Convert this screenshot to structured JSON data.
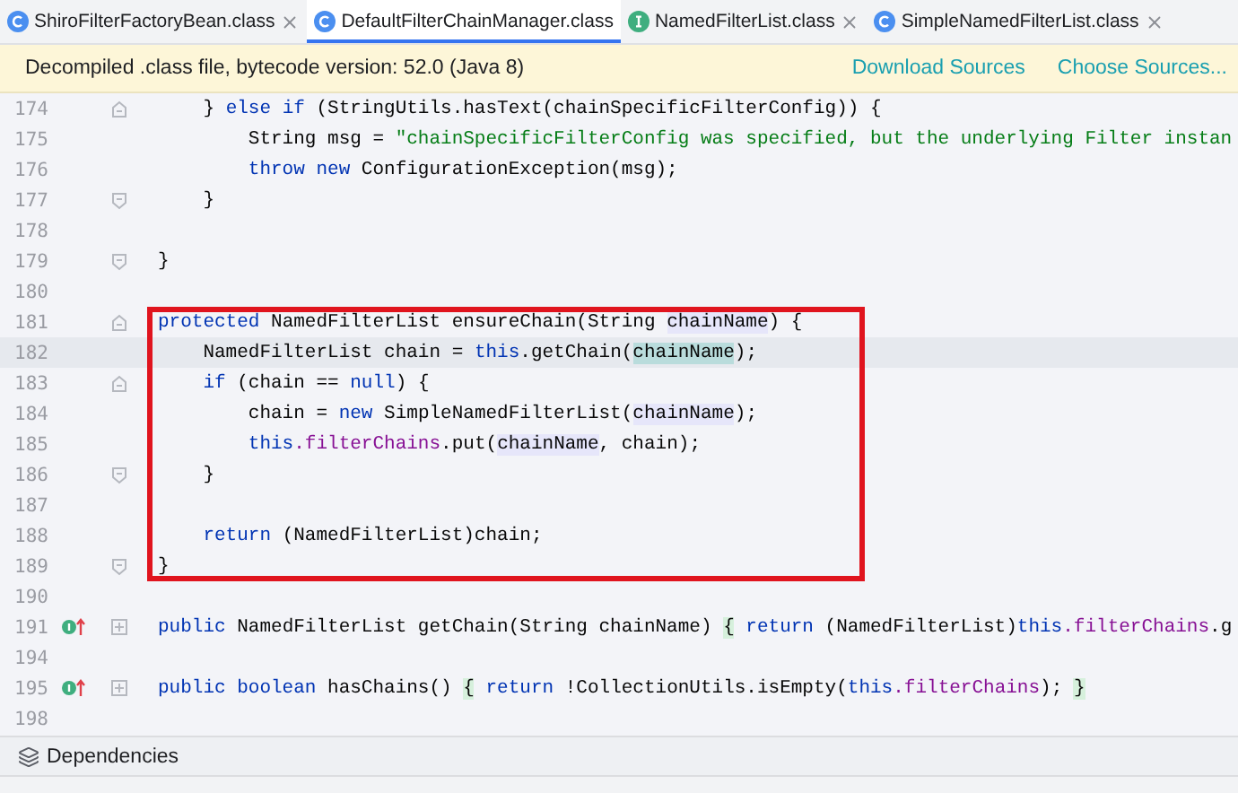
{
  "tabs": [
    {
      "label": "ShiroFilterFactoryBean.class",
      "kind": "class",
      "selected": false,
      "closable": true
    },
    {
      "label": "DefaultFilterChainManager.class",
      "kind": "class",
      "selected": true,
      "closable": false
    },
    {
      "label": "NamedFilterList.class",
      "kind": "interface",
      "selected": false,
      "closable": true
    },
    {
      "label": "SimpleNamedFilterList.class",
      "kind": "class",
      "selected": false,
      "closable": true
    }
  ],
  "banner": {
    "message": "Decompiled .class file, bytecode version: 52.0 (Java 8)",
    "links": [
      "Download Sources",
      "Choose Sources..."
    ]
  },
  "code_lines": [
    {
      "number": "174",
      "gutter": [
        {
          "kind": "fold_start"
        }
      ],
      "current": false,
      "boxed": false,
      "tokens": [
        {
          "kind": "plain",
          "text": "    } "
        },
        {
          "kind": "keyword",
          "text": "else if"
        },
        {
          "kind": "plain",
          "text": " (StringUtils.hasText(chainSpecificFilterConfig)) {"
        }
      ]
    },
    {
      "number": "175",
      "current": false,
      "boxed": false,
      "tokens": [
        {
          "kind": "plain",
          "text": "        String msg = "
        },
        {
          "kind": "string",
          "text": "\"chainSpecificFilterConfig was specified, but the underlying Filter instan"
        }
      ]
    },
    {
      "number": "176",
      "current": false,
      "boxed": false,
      "tokens": [
        {
          "kind": "keyword",
          "text": "        throw new"
        },
        {
          "kind": "plain",
          "text": " ConfigurationException(msg);"
        }
      ]
    },
    {
      "number": "177",
      "gutter": [
        {
          "kind": "fold_end"
        }
      ],
      "current": false,
      "boxed": false,
      "tokens": [
        {
          "kind": "plain",
          "text": "    }"
        }
      ]
    },
    {
      "number": "178",
      "current": false,
      "boxed": false
    },
    {
      "number": "179",
      "gutter": [
        {
          "kind": "fold_end"
        }
      ],
      "current": false,
      "boxed": false,
      "tokens": [
        {
          "kind": "plain",
          "text": "}"
        }
      ]
    },
    {
      "number": "180",
      "current": false,
      "boxed": false
    },
    {
      "number": "181",
      "gutter": [
        {
          "kind": "fold_start"
        }
      ],
      "current": false,
      "boxed": true,
      "tokens": [
        {
          "kind": "keyword",
          "text": "protected"
        },
        {
          "kind": "plain",
          "text": " NamedFilterList ensureChain(String "
        },
        {
          "kind": "param",
          "text": "chainName"
        },
        {
          "kind": "plain",
          "text": ") {"
        }
      ]
    },
    {
      "number": "182",
      "current": true,
      "boxed": true,
      "tokens": [
        {
          "kind": "plain",
          "text": "    NamedFilterList chain = "
        },
        {
          "kind": "keyword",
          "text": "this"
        },
        {
          "kind": "plain",
          "text": ".getChain("
        },
        {
          "kind": "param_current",
          "text": "chainName"
        },
        {
          "kind": "plain",
          "text": ");"
        }
      ]
    },
    {
      "number": "183",
      "gutter": [
        {
          "kind": "fold_start"
        }
      ],
      "current": false,
      "boxed": true,
      "tokens": [
        {
          "kind": "keyword",
          "text": "    if"
        },
        {
          "kind": "plain",
          "text": " (chain == "
        },
        {
          "kind": "keyword",
          "text": "null"
        },
        {
          "kind": "plain",
          "text": ") {"
        }
      ]
    },
    {
      "number": "184",
      "current": false,
      "boxed": true,
      "tokens": [
        {
          "kind": "plain",
          "text": "        chain = "
        },
        {
          "kind": "keyword",
          "text": "new"
        },
        {
          "kind": "plain",
          "text": " SimpleNamedFilterList("
        },
        {
          "kind": "param",
          "text": "chainName"
        },
        {
          "kind": "plain",
          "text": ");"
        }
      ]
    },
    {
      "number": "185",
      "current": false,
      "boxed": true,
      "tokens": [
        {
          "kind": "keyword",
          "text": "        this"
        },
        {
          "kind": "field",
          "text": ".filterChains"
        },
        {
          "kind": "plain",
          "text": ".put("
        },
        {
          "kind": "param",
          "text": "chainName"
        },
        {
          "kind": "plain",
          "text": ", chain);"
        }
      ]
    },
    {
      "number": "186",
      "gutter": [
        {
          "kind": "fold_end"
        }
      ],
      "current": false,
      "boxed": true,
      "tokens": [
        {
          "kind": "plain",
          "text": "    }"
        }
      ]
    },
    {
      "number": "187",
      "current": false,
      "boxed": true
    },
    {
      "number": "188",
      "current": false,
      "boxed": true,
      "tokens": [
        {
          "kind": "keyword",
          "text": "    return"
        },
        {
          "kind": "plain",
          "text": " (NamedFilterList)chain;"
        }
      ]
    },
    {
      "number": "189",
      "gutter": [
        {
          "kind": "fold_end"
        }
      ],
      "current": false,
      "boxed": true,
      "tokens": [
        {
          "kind": "plain",
          "text": "}"
        }
      ]
    },
    {
      "number": "190",
      "current": false,
      "boxed": false
    },
    {
      "number": "191",
      "gutter": [
        {
          "kind": "override"
        },
        {
          "kind": "collapsed"
        }
      ],
      "current": false,
      "boxed": false,
      "tokens": [
        {
          "kind": "keyword",
          "text": "public"
        },
        {
          "kind": "plain",
          "text": " NamedFilterList getChain(String chainName) "
        },
        {
          "kind": "brace",
          "text": "{"
        },
        {
          "kind": "keyword",
          "text": " return"
        },
        {
          "kind": "plain",
          "text": " (NamedFilterList)"
        },
        {
          "kind": "keyword",
          "text": "this"
        },
        {
          "kind": "field",
          "text": ".filterChains"
        },
        {
          "kind": "plain",
          "text": ".g"
        }
      ]
    },
    {
      "number": "194",
      "current": false,
      "boxed": false
    },
    {
      "number": "195",
      "gutter": [
        {
          "kind": "override"
        },
        {
          "kind": "collapsed"
        }
      ],
      "current": false,
      "boxed": false,
      "tokens": [
        {
          "kind": "keyword",
          "text": "public boolean"
        },
        {
          "kind": "plain",
          "text": " hasChains() "
        },
        {
          "kind": "brace",
          "text": "{"
        },
        {
          "kind": "keyword",
          "text": " return"
        },
        {
          "kind": "plain",
          "text": " !CollectionUtils.isEmpty("
        },
        {
          "kind": "keyword",
          "text": "this"
        },
        {
          "kind": "field",
          "text": ".filterChains"
        },
        {
          "kind": "plain",
          "text": "); "
        },
        {
          "kind": "brace",
          "text": "}"
        }
      ]
    },
    {
      "number": "198",
      "current": false,
      "boxed": false
    }
  ],
  "bottom_bar": {
    "button": "Dependencies"
  }
}
